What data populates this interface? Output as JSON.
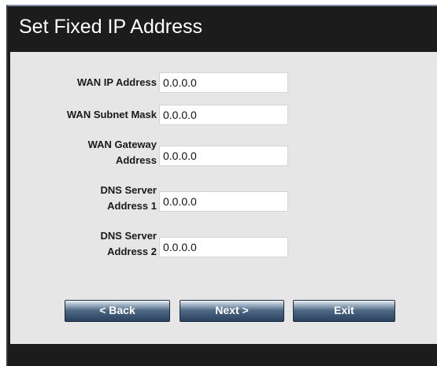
{
  "title": "Set Fixed IP Address",
  "fields": [
    {
      "label": "WAN IP Address",
      "value": "0.0.0.0"
    },
    {
      "label": "WAN Subnet Mask",
      "value": "0.0.0.0"
    },
    {
      "label_lines": [
        "WAN Gateway",
        "Address"
      ],
      "value": "0.0.0.0"
    },
    {
      "label_lines": [
        "DNS Server",
        "Address 1"
      ],
      "value": "0.0.0.0"
    },
    {
      "label_lines": [
        "DNS Server",
        "Address 2"
      ],
      "value": "0.0.0.0"
    }
  ],
  "buttons": {
    "back": "< Back",
    "next": "Next >",
    "exit": "Exit"
  },
  "colors": {
    "frame": "#1c1c1c",
    "panel": "#e6e6e6",
    "button_top": "#a9b9cb",
    "button_bottom": "#2b4260"
  }
}
